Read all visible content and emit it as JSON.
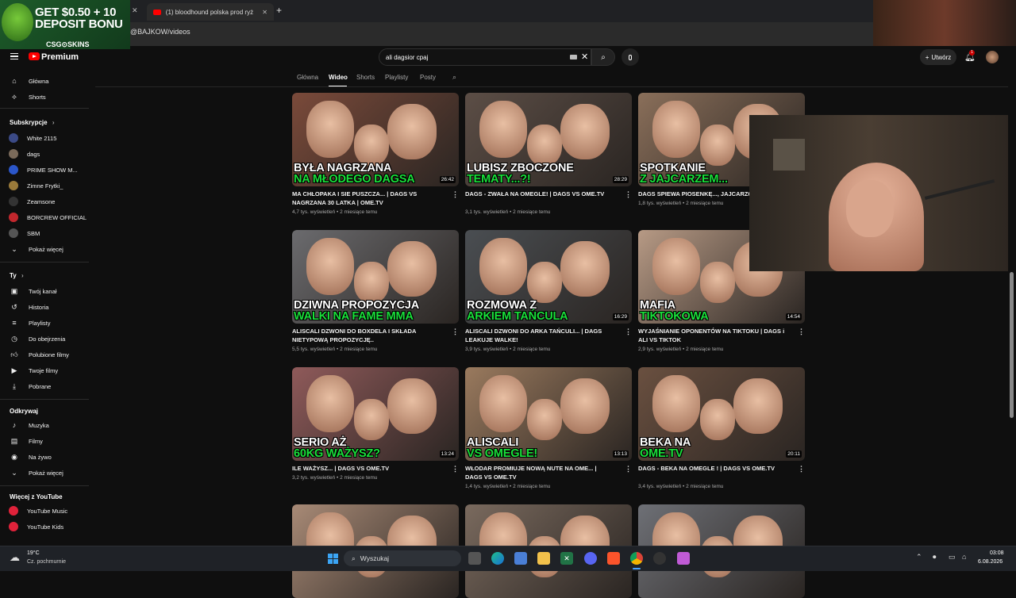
{
  "browser": {
    "tabs": [
      {
        "label": "(1) bloodhound polska prod ryż"
      }
    ],
    "new_tab_symbol": "+",
    "close_symbol": "✕",
    "url": "@BAJKOW/videos"
  },
  "ad_overlay": {
    "headline_1": "GET $0.50 + 10",
    "headline_2": "DEPOSIT BONU",
    "brand": "CSG⊙SKINS"
  },
  "header": {
    "premium_label": "Premium",
    "search_value": "ali dagsior cpaj",
    "create_label": "Utwórz",
    "notifications_count": "1"
  },
  "sidebar": {
    "top_items": [
      {
        "icon": "home-icon",
        "label": "Główna"
      },
      {
        "icon": "shorts-icon",
        "label": "Shorts"
      }
    ],
    "subscriptions_title": "Subskrypcje",
    "subscriptions": [
      {
        "label": "White 2115",
        "color": "#3b4a86"
      },
      {
        "label": "dags",
        "color": "#7a6a5a"
      },
      {
        "label": "PRIME SHOW M...",
        "color": "#2b56c9"
      },
      {
        "label": "Zimne Frytki_",
        "color": "#9a7a3a"
      },
      {
        "label": "Zeamsone",
        "color": "#333333"
      },
      {
        "label": "BORCREW OFFICIAL",
        "color": "#c2272d"
      },
      {
        "label": "SBM",
        "color": "#555555"
      }
    ],
    "show_more_label": "Pokaż więcej",
    "you_title": "Ty",
    "you_items": [
      {
        "icon": "your-channel-icon",
        "label": "Twój kanał"
      },
      {
        "icon": "history-icon",
        "label": "Historia"
      },
      {
        "icon": "playlists-icon",
        "label": "Playlisty"
      },
      {
        "icon": "watch-later-icon",
        "label": "Do obejrzenia"
      },
      {
        "icon": "liked-videos-icon",
        "label": "Polubione filmy"
      },
      {
        "icon": "your-videos-icon",
        "label": "Twoje filmy"
      },
      {
        "icon": "downloads-icon",
        "label": "Pobrane"
      }
    ],
    "explore_title": "Odkrywaj",
    "explore_items": [
      {
        "icon": "music-icon",
        "label": "Muzyka"
      },
      {
        "icon": "movies-icon",
        "label": "Filmy"
      },
      {
        "icon": "live-icon",
        "label": "Na żywo"
      },
      {
        "icon": "chevron-down-icon",
        "label": "Pokaż więcej"
      }
    ],
    "more_title": "Więcej z YouTube",
    "more_items": [
      {
        "label": "YouTube Music"
      },
      {
        "label": "YouTube Kids"
      }
    ]
  },
  "channel_tabs": [
    "Główna",
    "Wideo",
    "Shorts",
    "Playlisty",
    "Posty"
  ],
  "videos": [
    {
      "caption_1": "BYŁA NAGRZANA",
      "caption_2": "NA MŁODEGO DAGSA",
      "duration": "26:42",
      "title": "MA CHŁOPAKA I SIE PUSZCZA... | DAGS VS NAGRZANA 30 LATKA | OME.TV",
      "meta": "4,7 tys. wyświetleń • 2 miesiące temu",
      "bg": "#7a4a3a"
    },
    {
      "caption_1": "LUBISZ ZBOCZONE",
      "caption_2": "TEMATY...?!",
      "duration": "28:29",
      "title": "DAGS - ZWAŁA NA OMEGLE! | DAGS VS OME.TV",
      "meta": "3,1 tys. wyświetleń • 2 miesiące temu",
      "bg": "#5c4e46"
    },
    {
      "caption_1": "SPOTKANIE",
      "caption_2": "Z JAJCARZEM...",
      "duration": "",
      "title": "DAGS SPIEWA PIOSENKĘ..., JAJCARZ6",
      "meta": "1,8 tys. wyświetleń • 2 miesiące temu",
      "bg": "#8a6f5a"
    },
    {
      "caption_1": "DZIWNA PROPOZYCJA",
      "caption_2": "WALKI NA FAME MMA",
      "duration": "",
      "title": "ALISCALI DZWONI DO BOXDELA I SKŁADA NIETYPOWĄ PROPOZYCJĘ..",
      "meta": "5,5 tys. wyświetleń • 2 miesiące temu",
      "bg": "#6b6b6e"
    },
    {
      "caption_1": "ROZMOWA Z",
      "caption_2": "ARKIEM TAŃCULA",
      "duration": "16:29",
      "title": "ALISCALI DZWONI DO ARKA TAŃCULI... | DAGS LEAKUJE WALKE!",
      "meta": "3,9 tys. wyświetleń • 2 miesiące temu",
      "bg": "#4a4e52"
    },
    {
      "caption_1": "MAFIA",
      "caption_2": "TIKTOKOWA",
      "duration": "14:54",
      "title": "WYJAŚNIANIE OPONENTÓW NA TIKTOKU | DAGS i ALI VS TIKTOK",
      "meta": "2,9 tys. wyświetleń • 2 miesiące temu",
      "bg": "#b79a85"
    },
    {
      "caption_1": "SERIO AŻ",
      "caption_2": "60KG WAŻYSZ?",
      "duration": "13:24",
      "title": "ILE WAŻYSZ... | DAGS VS OME.TV",
      "meta": "3,2 tys. wyświetleń • 2 miesiące temu",
      "bg": "#8f5a5a"
    },
    {
      "caption_1": "ALISCALI",
      "caption_2": "VS OMEGLE!",
      "duration": "13:13",
      "title": "WŁODAR PROMIUJE NOWĄ NUTE NA OME... | DAGS VS OME.TV",
      "meta": "1,4 tys. wyświetleń • 2 miesiące temu",
      "bg": "#9a7a5e"
    },
    {
      "caption_1": "BEKA NA",
      "caption_2": "OME.TV",
      "duration": "20:11",
      "title": "DAGS - BEKA NA OMEGLE ! | DAGS VS OME.TV",
      "meta": "3,4 tys. wyświetleń • 2 miesiące temu",
      "bg": "#6a5040"
    },
    {
      "caption_1": "",
      "caption_2": "",
      "duration": "",
      "title": "",
      "meta": "",
      "bg": "#a88a76"
    },
    {
      "caption_1": "",
      "caption_2": "",
      "duration": "",
      "title": "",
      "meta": "",
      "bg": "#7a6a5e"
    },
    {
      "caption_1": "",
      "caption_2": "",
      "duration": "",
      "title": "",
      "meta": "",
      "bg": "#6e7076"
    }
  ],
  "taskbar": {
    "weather_temp": "19°C",
    "weather_desc": "Cz. pochmurnie",
    "search_placeholder": "Wyszukaj",
    "time": "03:08",
    "date": "6.08.2026"
  }
}
